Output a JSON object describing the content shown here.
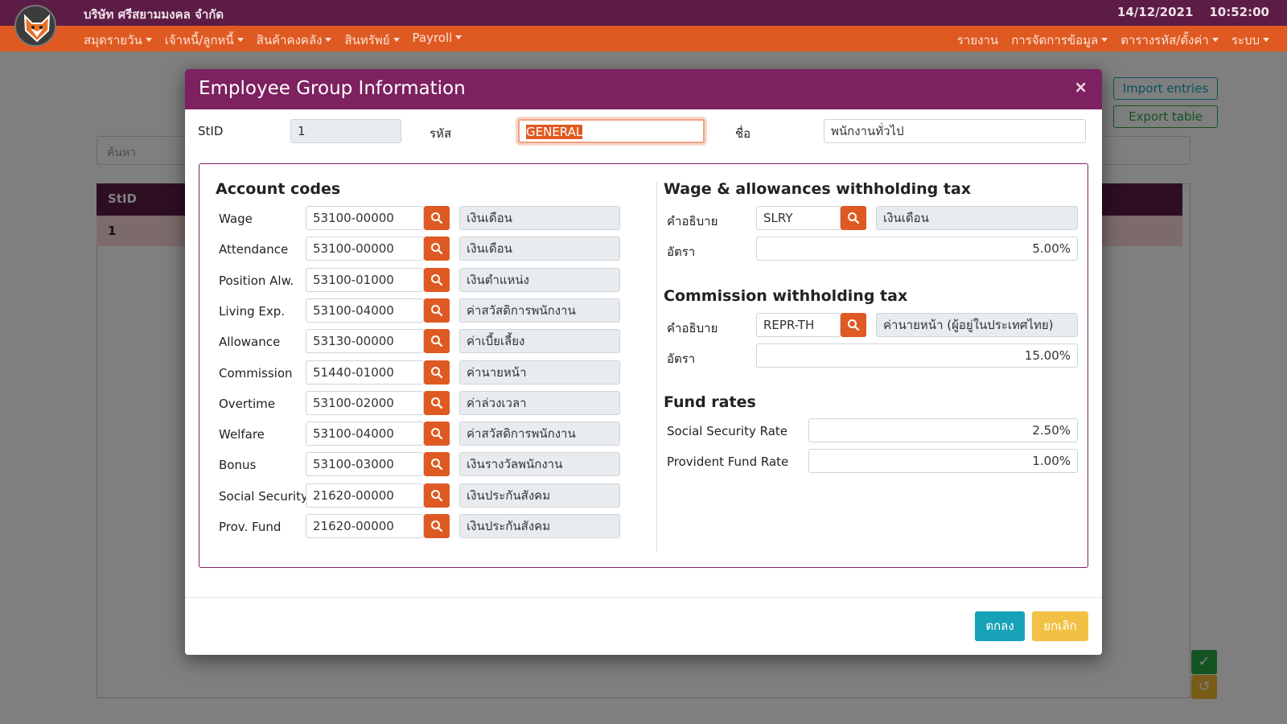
{
  "header": {
    "company": "บริษัท ศรีสยามมงคล จำกัด",
    "date": "14/12/2021",
    "time": "10:52:00",
    "menu_left": [
      "สมุดรายวัน",
      "เจ้าหนี้/ลูกหนี้",
      "สินค้าคงคลัง",
      "สินทรัพย์",
      "Payroll"
    ],
    "menu_right": [
      {
        "label": "รายงาน",
        "dropdown": false
      },
      {
        "label": "การจัดการข้อมูล",
        "dropdown": true
      },
      {
        "label": "ตารางรหัส/ตั้งค่า",
        "dropdown": true
      },
      {
        "label": "ระบบ",
        "dropdown": true
      }
    ]
  },
  "background": {
    "import_label": "Import entries",
    "export_label": "Export table",
    "search_placeholder": "ค้นหา",
    "table_header_stid": "StID",
    "table_row_stid": "1"
  },
  "modal": {
    "title": "Employee Group Information",
    "close_symbol": "×",
    "top": {
      "stid_label": "StID",
      "stid_value": "1",
      "code_label": "รหัส",
      "code_value": "GENERAL",
      "name_label": "ชื่อ",
      "name_value": "พนักงานทั่วไป"
    },
    "account_codes": {
      "title": "Account codes",
      "rows": [
        {
          "label": "Wage",
          "code": "53100-00000",
          "desc": "เงินเดือน"
        },
        {
          "label": "Attendance",
          "code": "53100-00000",
          "desc": "เงินเดือน"
        },
        {
          "label": "Position Alw.",
          "code": "53100-01000",
          "desc": "เงินตำแหน่ง"
        },
        {
          "label": "Living Exp.",
          "code": "53100-04000",
          "desc": "ค่าสวัสดิการพนักงาน"
        },
        {
          "label": "Allowance",
          "code": "53130-00000",
          "desc": "ค่าเบี้ยเลี้ยง"
        },
        {
          "label": "Commission",
          "code": "51440-01000",
          "desc": "ค่านายหน้า"
        },
        {
          "label": "Overtime",
          "code": "53100-02000",
          "desc": "ค่าล่วงเวลา"
        },
        {
          "label": "Welfare",
          "code": "53100-04000",
          "desc": "ค่าสวัสดิการพนักงาน"
        },
        {
          "label": "Bonus",
          "code": "53100-03000",
          "desc": "เงินรางวัลพนักงาน"
        },
        {
          "label": "Social Security",
          "code": "21620-00000",
          "desc": "เงินประกันสังคม"
        },
        {
          "label": "Prov. Fund",
          "code": "21620-00000",
          "desc": "เงินประกันสังคม"
        }
      ]
    },
    "wage_tax": {
      "title": "Wage & allowances withholding tax",
      "desc_label": "คำอธิบาย",
      "code": "SLRY",
      "desc": "เงินเดือน",
      "rate_label": "อัตรา",
      "rate": "5.00%"
    },
    "commission_tax": {
      "title": "Commission withholding tax",
      "desc_label": "คำอธิบาย",
      "code": "REPR-TH",
      "desc": "ค่านายหน้า (ผู้อยู่ในประเทศไทย)",
      "rate_label": "อัตรา",
      "rate": "15.00%"
    },
    "fund_rates": {
      "title": "Fund rates",
      "social_label": "Social Security Rate",
      "social_value": "2.50%",
      "provident_label": "Provident Fund Rate",
      "provident_value": "1.00%"
    },
    "ok_label": "ตกลง",
    "cancel_label": "ยกเลิก"
  },
  "colors": {
    "header_top": "#5c1c45",
    "header_menu": "#df5a22",
    "modal_header": "#7d2160",
    "search_button": "#df5a22",
    "ok_button": "#17a2b8",
    "cancel_button": "#f2c044"
  }
}
